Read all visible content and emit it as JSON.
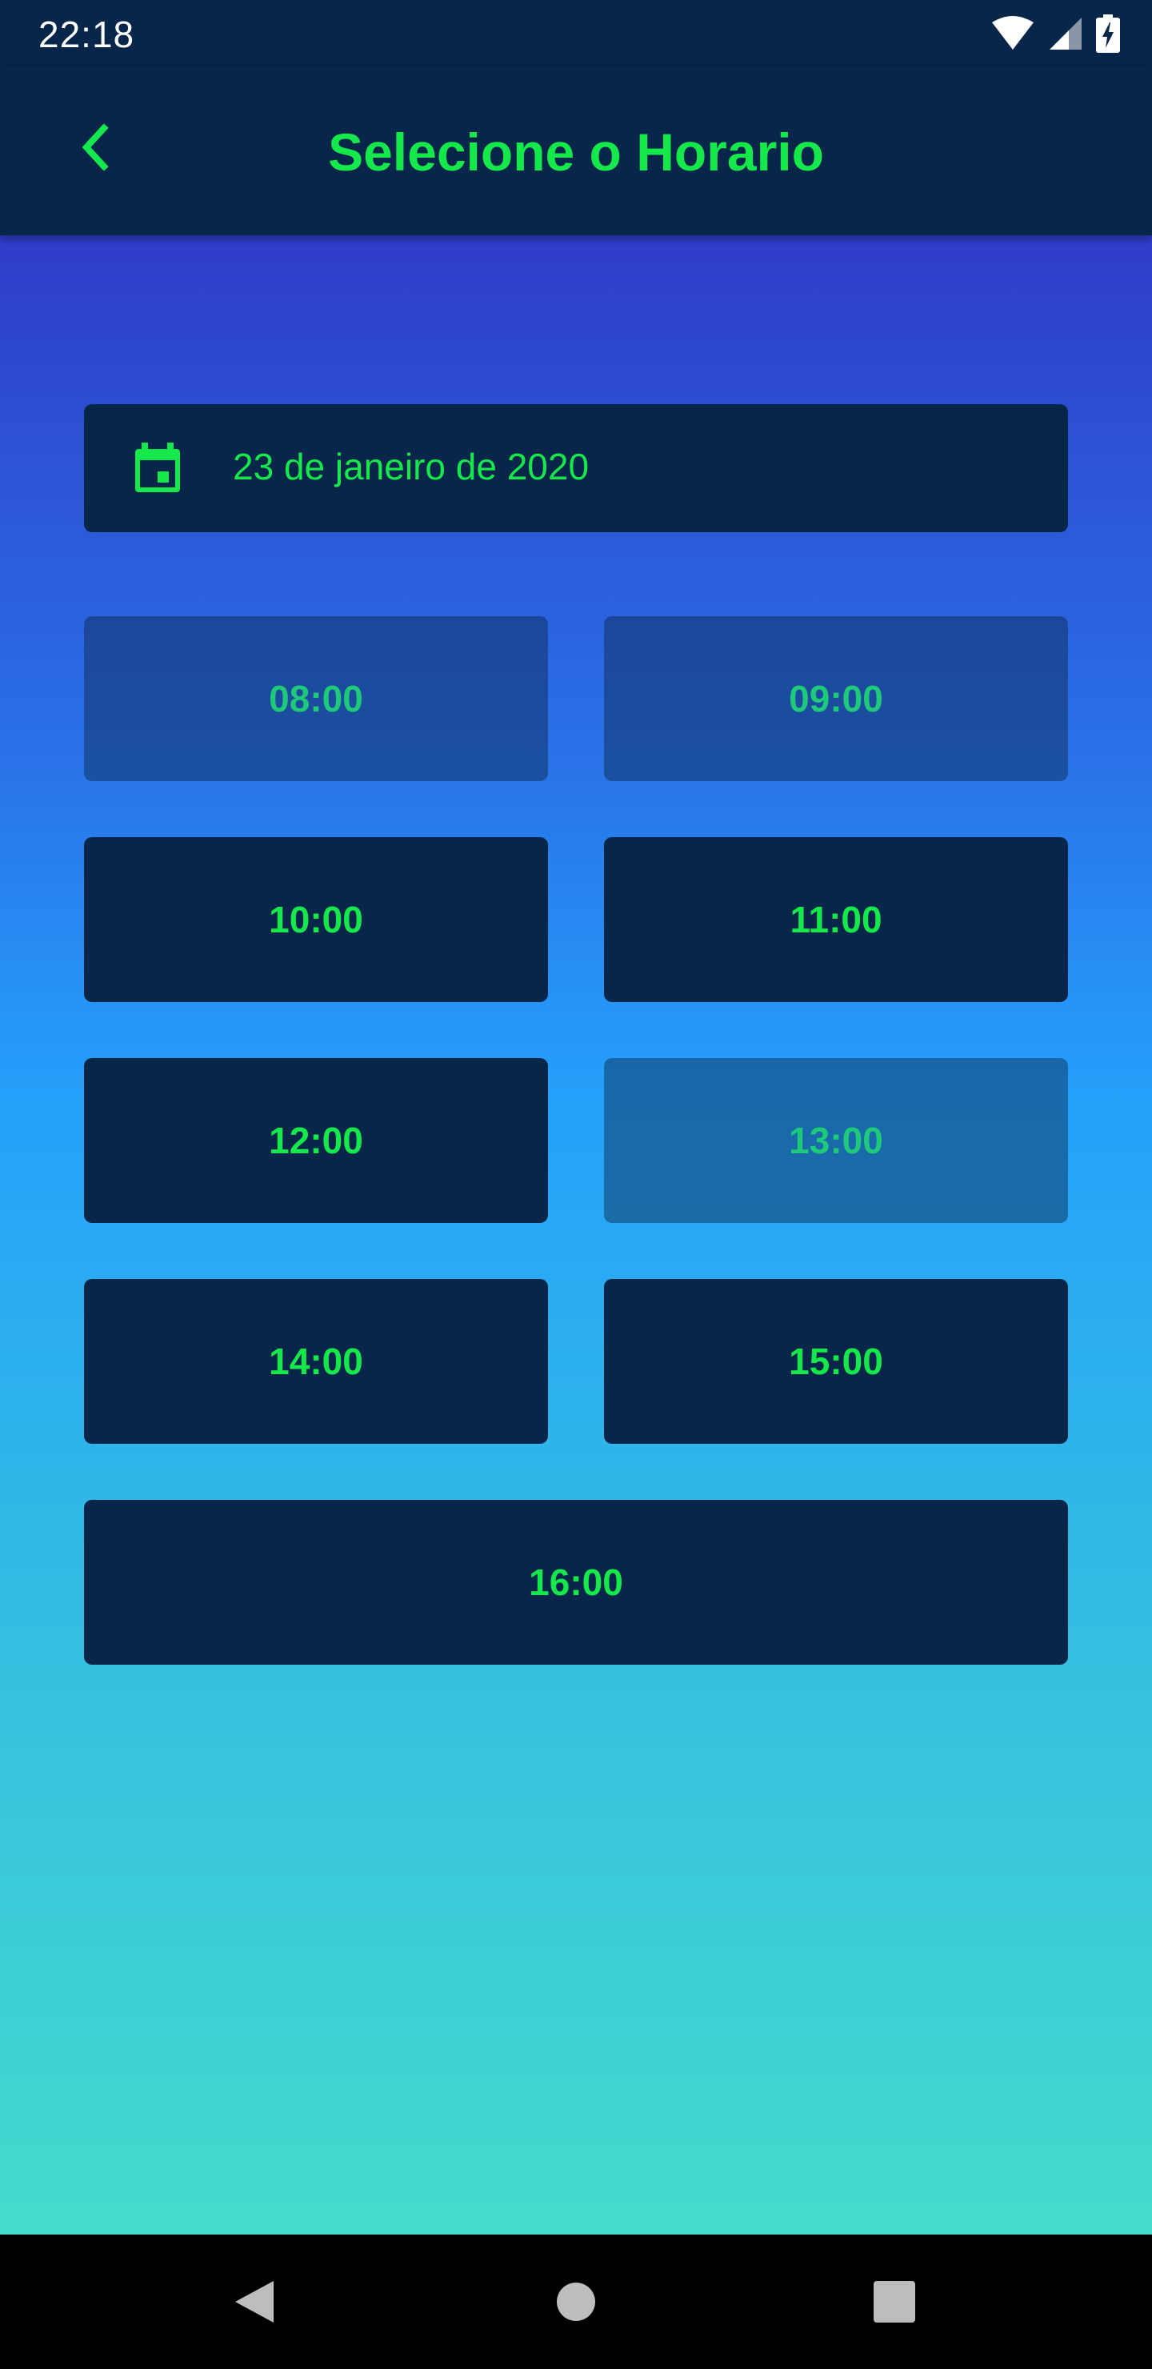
{
  "status_bar": {
    "time": "22:18",
    "icons": [
      "wifi-icon",
      "signal-icon",
      "battery-charging-icon"
    ]
  },
  "app_bar": {
    "back_icon": "chevron-left-icon",
    "title": "Selecione o Horario"
  },
  "date_picker": {
    "icon": "calendar-icon",
    "value": "23 de janeiro de 2020"
  },
  "time_slots": [
    {
      "label": "08:00",
      "available": false
    },
    {
      "label": "09:00",
      "available": false
    },
    {
      "label": "10:00",
      "available": true
    },
    {
      "label": "11:00",
      "available": true
    },
    {
      "label": "12:00",
      "available": true
    },
    {
      "label": "13:00",
      "available": false
    },
    {
      "label": "14:00",
      "available": true
    },
    {
      "label": "15:00",
      "available": true
    },
    {
      "label": "16:00",
      "available": true
    }
  ],
  "nav_bar": {
    "buttons": [
      "back-triangle-icon",
      "home-circle-icon",
      "recents-square-icon"
    ]
  },
  "colors": {
    "accent": "#14e84a",
    "dark_navy": "#08264a",
    "gradient_top": "#2f3cc9",
    "gradient_bottom": "#45dbcc"
  }
}
